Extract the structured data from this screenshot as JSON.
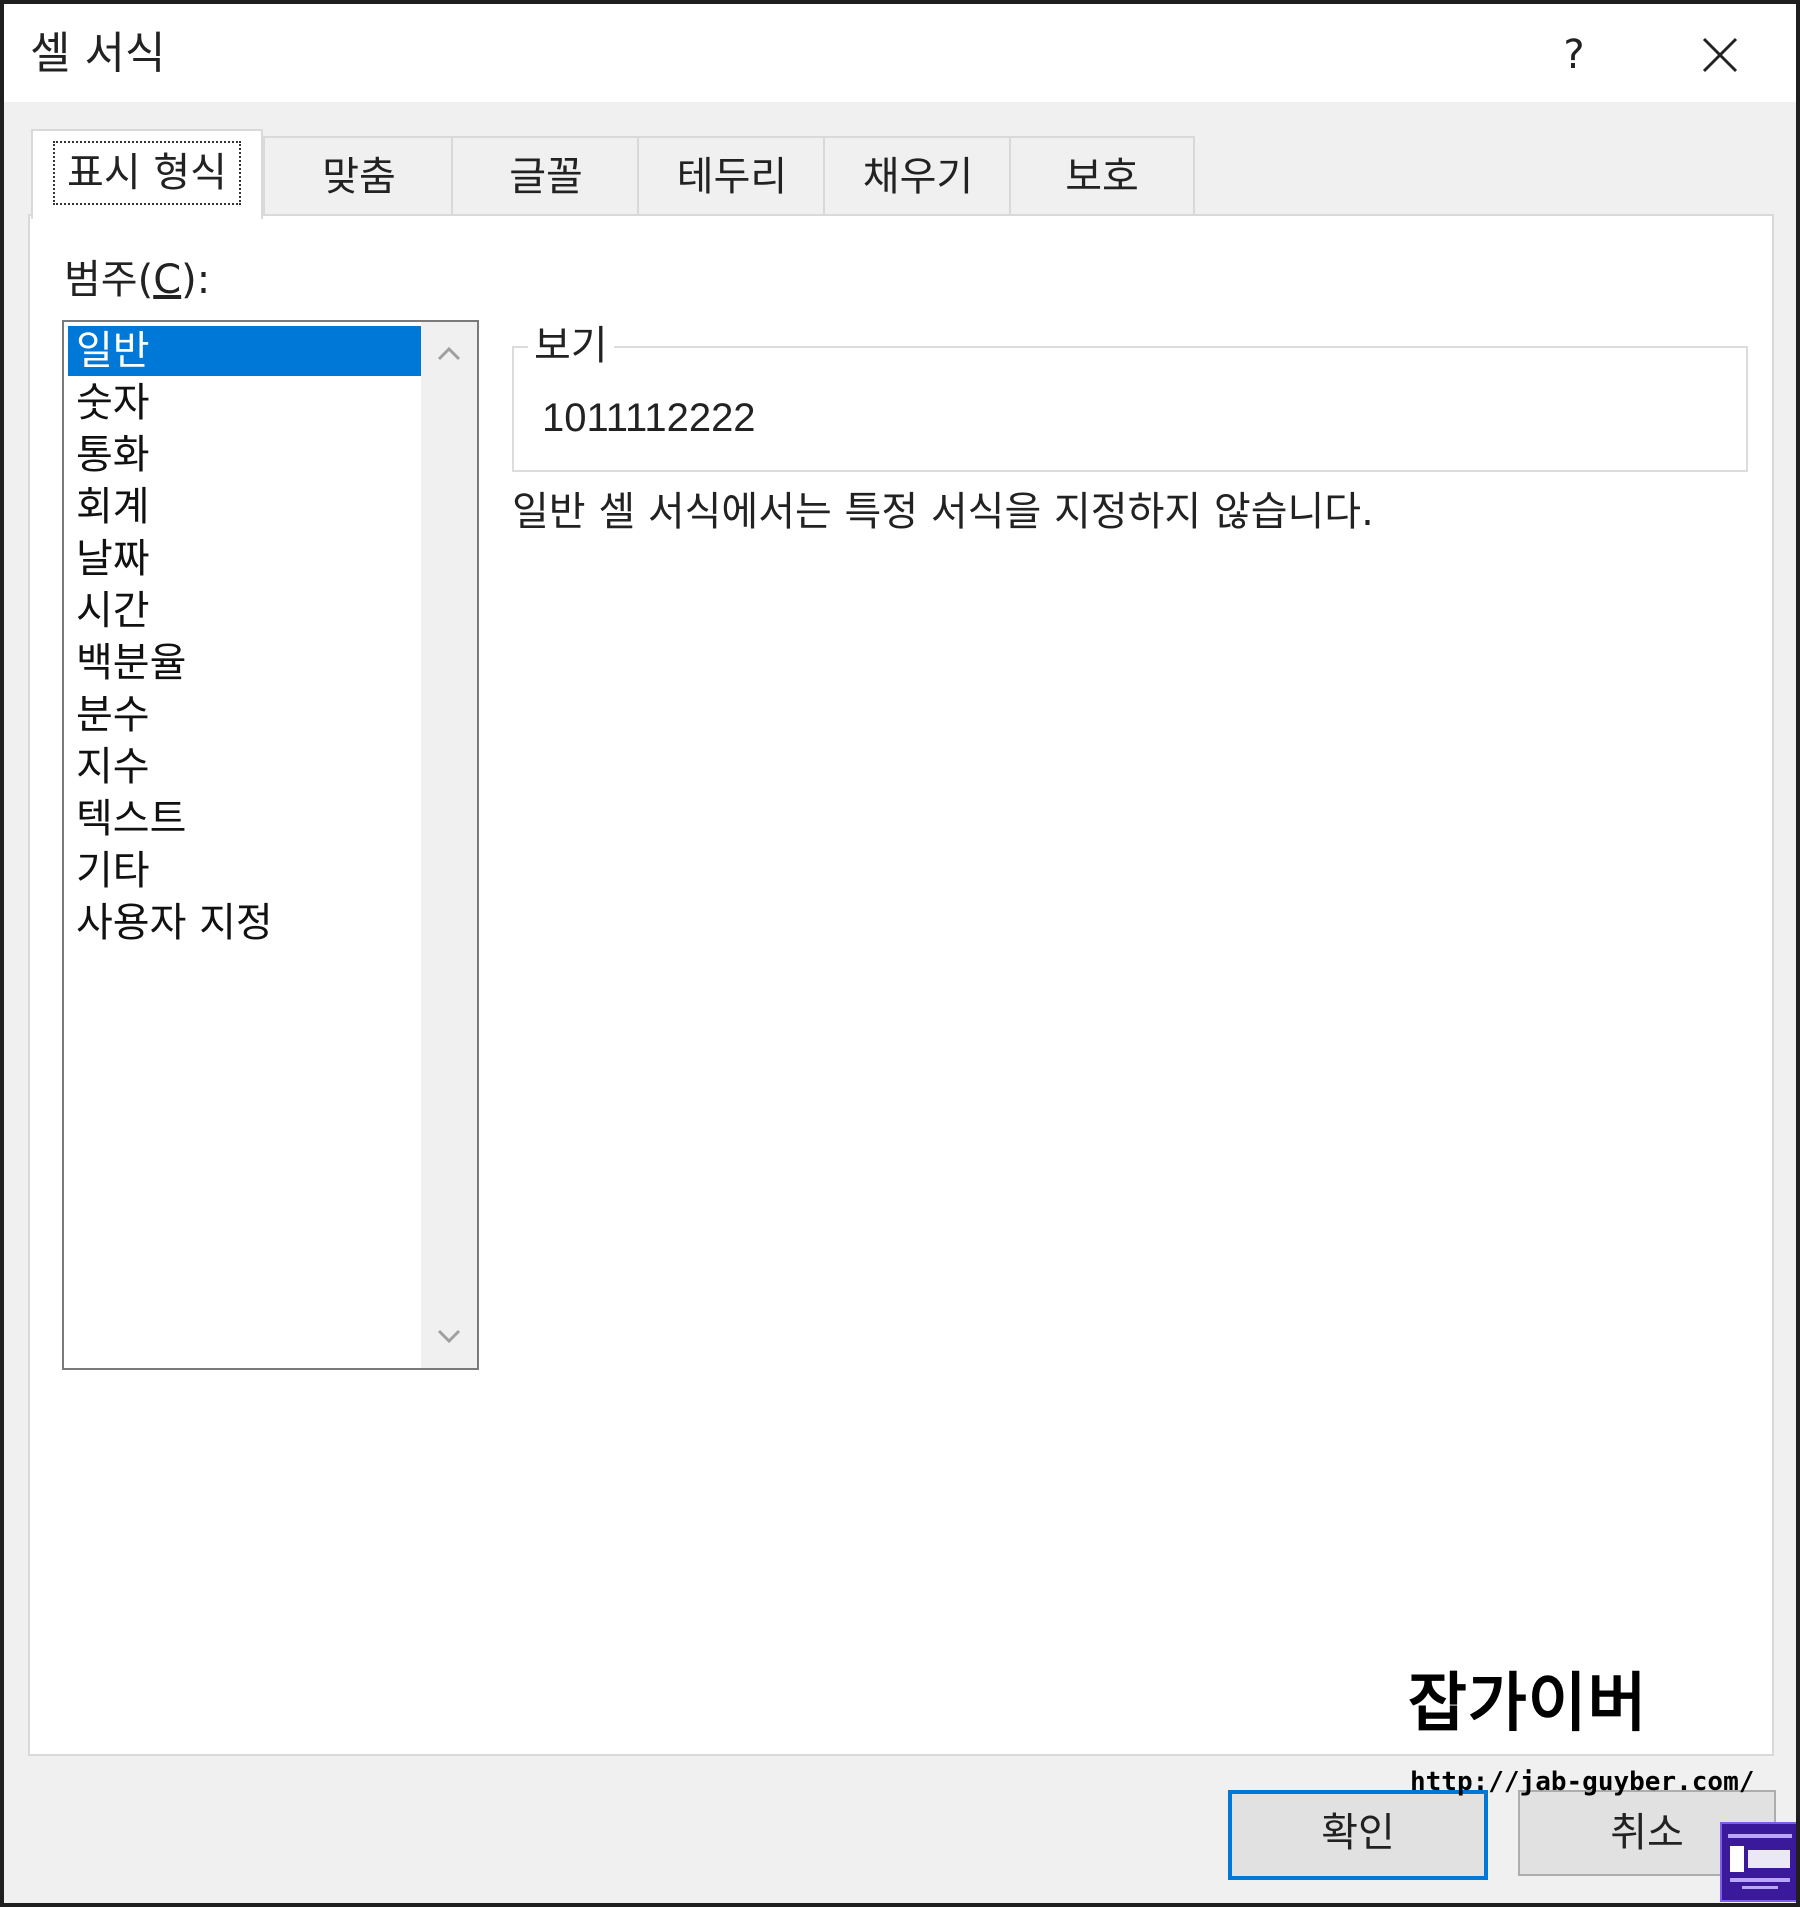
{
  "window": {
    "title": "셀 서식",
    "help_label": "?"
  },
  "tabs": [
    {
      "label": "표시 형식",
      "active": true
    },
    {
      "label": "맞춤",
      "active": false
    },
    {
      "label": "글꼴",
      "active": false
    },
    {
      "label": "테두리",
      "active": false
    },
    {
      "label": "채우기",
      "active": false
    },
    {
      "label": "보호",
      "active": false
    }
  ],
  "category": {
    "label_prefix": "범주(",
    "label_accel": "C",
    "label_suffix": "):",
    "items": [
      "일반",
      "숫자",
      "통화",
      "회계",
      "날짜",
      "시간",
      "백분율",
      "분수",
      "지수",
      "텍스트",
      "기타",
      "사용자 지정"
    ],
    "selected": "일반"
  },
  "sample": {
    "legend": "보기",
    "value": "1011112222"
  },
  "description": "일반 셀 서식에서는 특정 서식을 지정하지 않습니다.",
  "buttons": {
    "ok": "확인",
    "cancel": "취소"
  },
  "watermark": {
    "name": "잡가이버",
    "url": "http://jab-guyber.com/"
  },
  "colors": {
    "selection": "#0078d7",
    "ok_border": "#0078d7",
    "watermark_logo": "#3a1a9a"
  }
}
